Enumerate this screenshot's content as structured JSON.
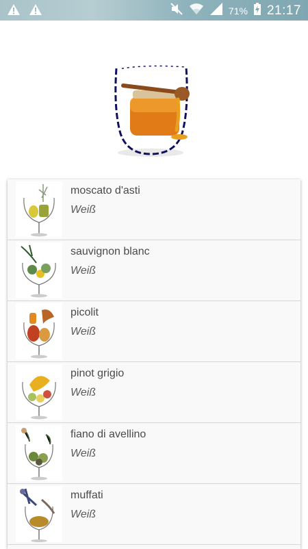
{
  "status_bar": {
    "battery_percent": "71%",
    "time": "21:17",
    "icons": [
      "warning-icon",
      "warning-icon",
      "mute-icon",
      "wifi-icon",
      "signal-icon",
      "battery-charging-icon"
    ]
  },
  "header_image": {
    "icon": "honey-jar-glass-image"
  },
  "wines": [
    {
      "name": "moscato d'asti",
      "type": "Weiß",
      "icon": "wine-glass-image"
    },
    {
      "name": "sauvignon blanc",
      "type": "Weiß",
      "icon": "wine-glass-image"
    },
    {
      "name": "picolit",
      "type": "Weiß",
      "icon": "wine-glass-image"
    },
    {
      "name": "pinot grigio",
      "type": "Weiß",
      "icon": "wine-glass-image"
    },
    {
      "name": "fiano di avellino",
      "type": "Weiß",
      "icon": "wine-glass-image"
    },
    {
      "name": "muffati",
      "type": "Weiß",
      "icon": "wine-glass-image"
    }
  ],
  "colors": {
    "status_bar": "#8fb3bc",
    "divider": "#d6d6d6",
    "list_bg": "#f9f9f9"
  }
}
